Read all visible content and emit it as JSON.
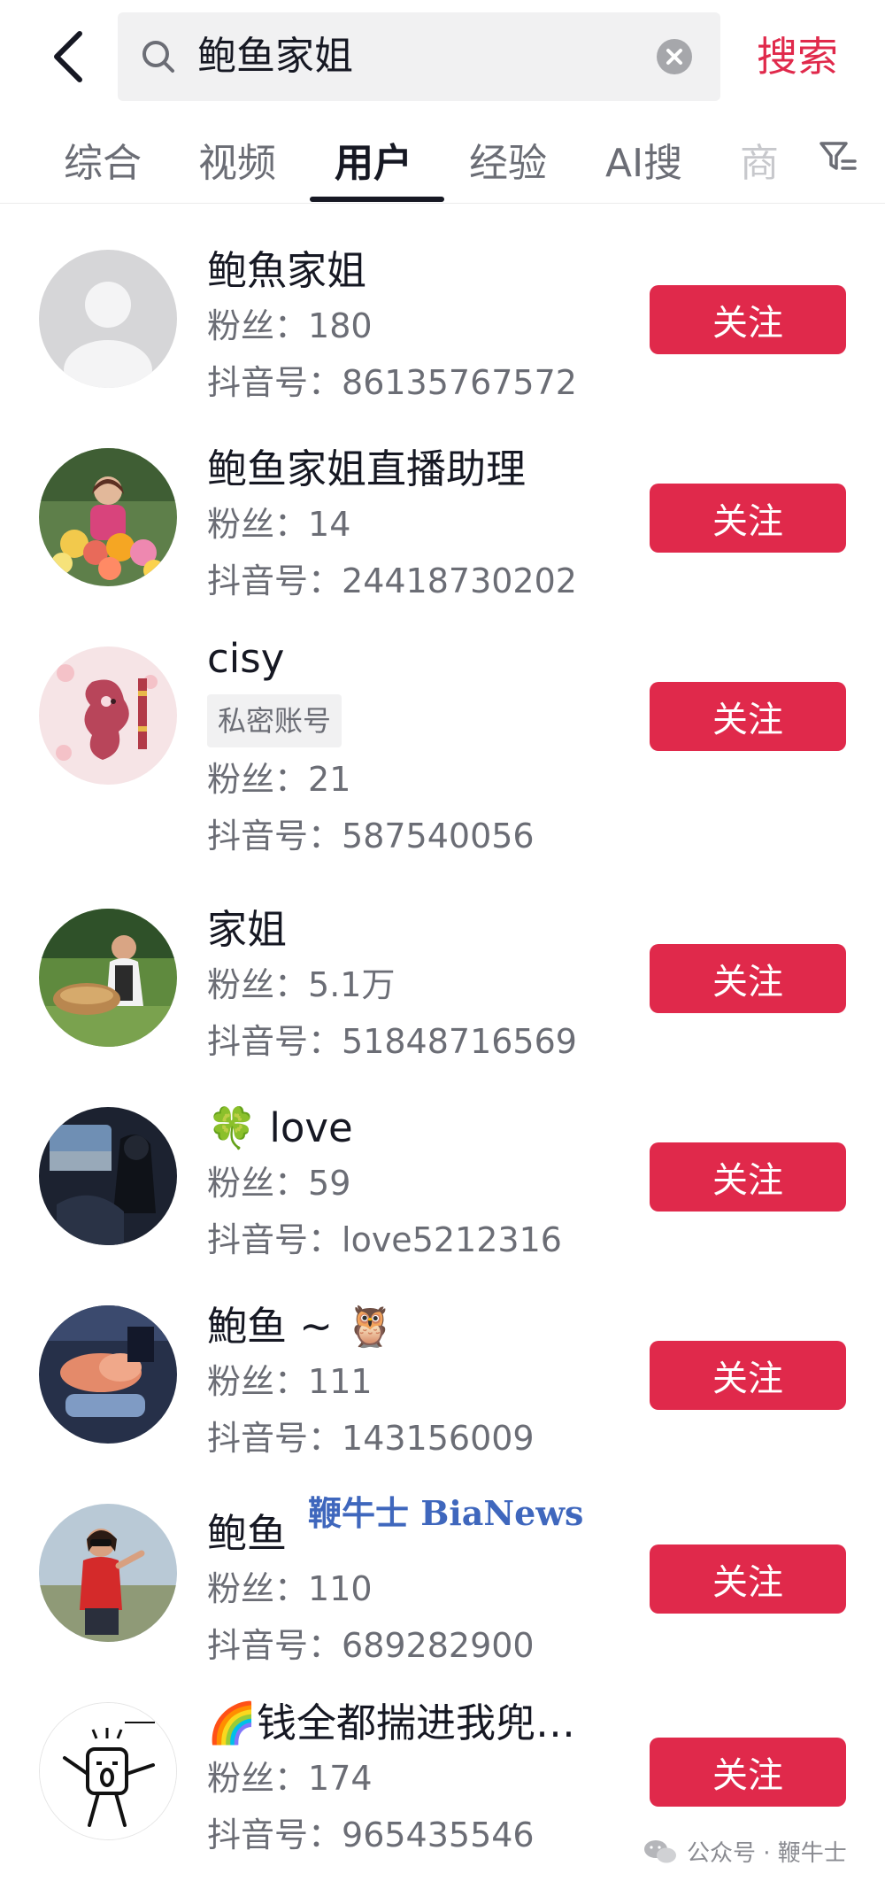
{
  "search": {
    "query": "鲍鱼家姐",
    "submit_label": "搜索"
  },
  "tabs": [
    {
      "label": "综合"
    },
    {
      "label": "视频"
    },
    {
      "label": "用户",
      "active": true
    },
    {
      "label": "经验"
    },
    {
      "label": "AI搜"
    },
    {
      "label": "商"
    }
  ],
  "icons": {
    "back": "chevron-left-icon",
    "search": "search-icon",
    "clear": "clear-icon",
    "filter": "filter-icon"
  },
  "colors": {
    "accent": "#e0294b",
    "text": "#161823",
    "muted": "#6b6d75",
    "watermark": "#2f5bb8"
  },
  "labels": {
    "fans": "粉丝：",
    "douyin_id": "抖音号：",
    "follow": "关注"
  },
  "users": [
    {
      "name": "鲍魚家姐",
      "fans": "180",
      "douyin_id": "86135767572",
      "avatar": "default-avatar"
    },
    {
      "name": "鲍鱼家姐直播助理",
      "fans": "14",
      "douyin_id": "24418730202",
      "avatar": "woman-with-flowers"
    },
    {
      "name": "cisy",
      "tag": "私密账号",
      "fans": "21",
      "douyin_id": "587540056",
      "avatar": "dragon-illustration"
    },
    {
      "name": "家姐",
      "fans": "5.1万",
      "douyin_id": "51848716569",
      "avatar": "woman-with-basket"
    },
    {
      "name": "🍀 love",
      "fans": "59",
      "douyin_id": "love5212316",
      "avatar": "person-in-car"
    },
    {
      "name": "鮑鱼 ~ 🦉",
      "fans": "111",
      "douyin_id": "143156009",
      "avatar": "blurred-photo"
    },
    {
      "name": "鲍鱼",
      "fans": "110",
      "douyin_id": "689282900",
      "avatar": "woman-in-red"
    },
    {
      "name": "🌈钱全都揣进我兜…",
      "fans": "174",
      "douyin_id": "965435546",
      "avatar": "stick-figure-drawing"
    }
  ],
  "watermark": "鞭牛士 BiaNews",
  "footer": "公众号 · 鞭牛士"
}
